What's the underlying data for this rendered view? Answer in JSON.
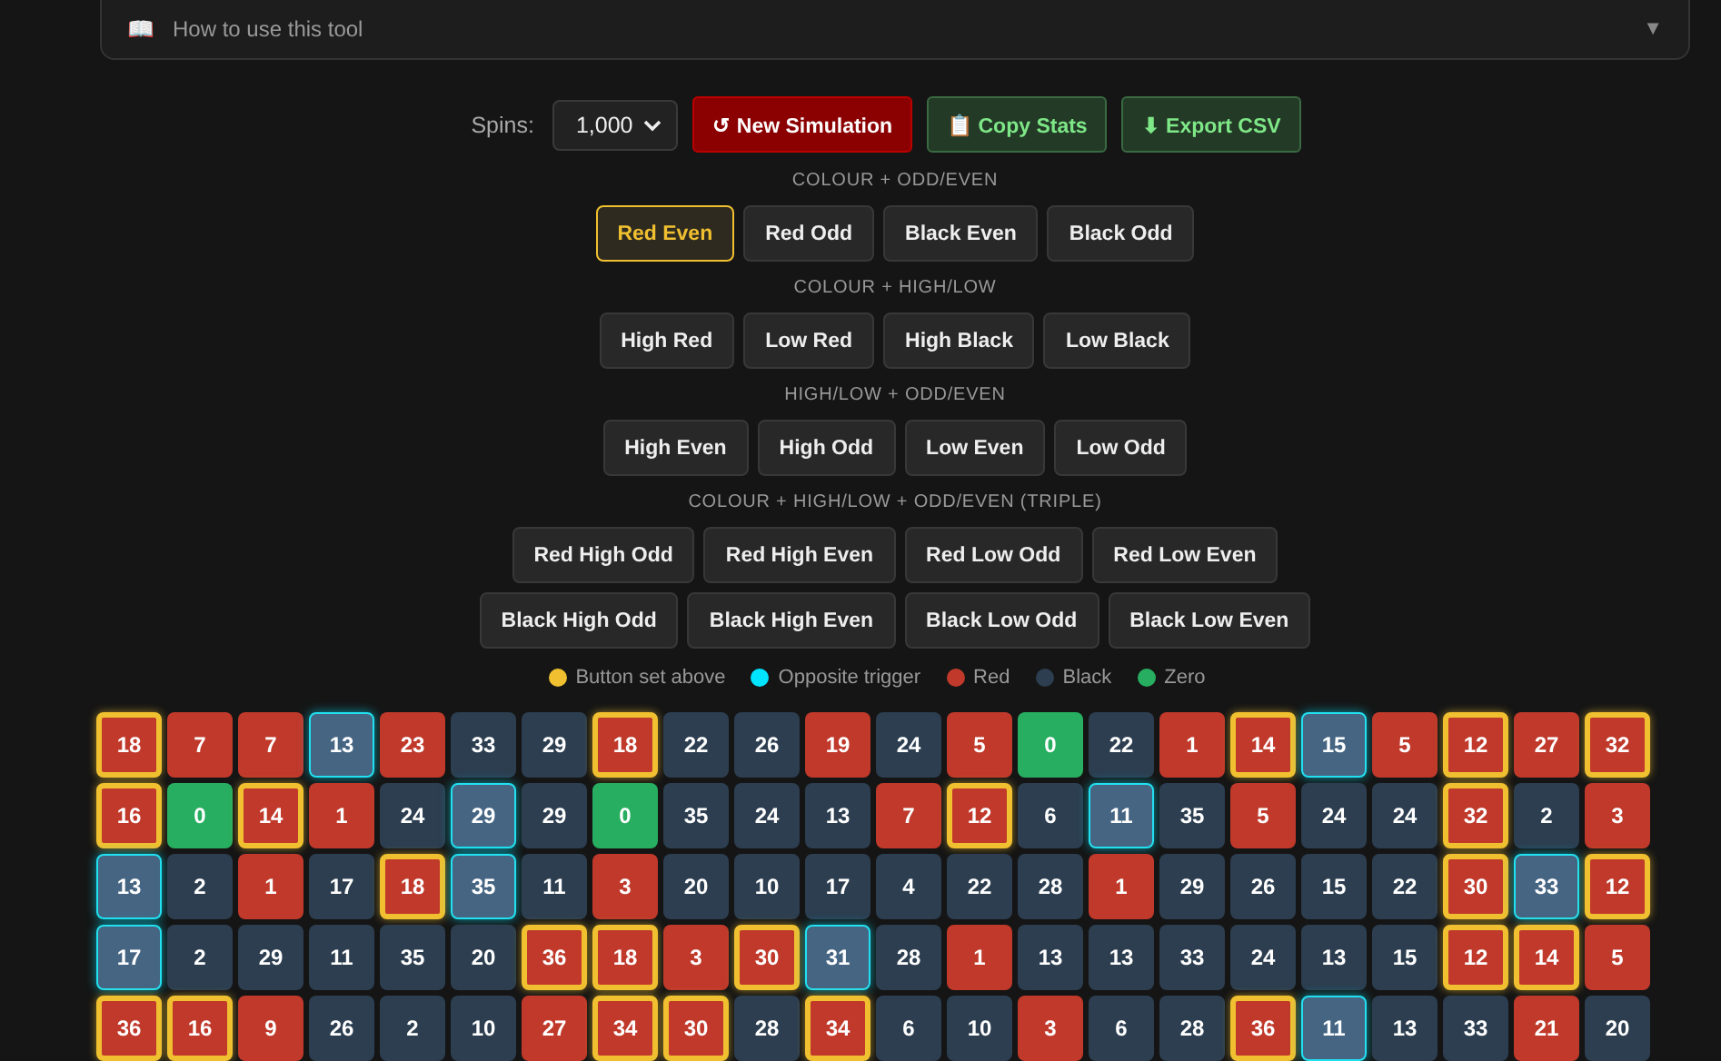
{
  "help": {
    "icon": "📖",
    "title": "How to use this tool",
    "chevron": "▼",
    "expanded": false
  },
  "controls": {
    "spins_label": "Spins:",
    "spins_value": "1,000",
    "buttons": [
      {
        "kind": "danger",
        "icon": "↺",
        "label": "New Simulation"
      },
      {
        "kind": "success",
        "icon": "📋",
        "label": "Copy Stats"
      },
      {
        "kind": "success",
        "icon": "⬇",
        "label": "Export CSV"
      }
    ]
  },
  "button_groups": [
    {
      "title": "COLOUR + ODD/EVEN",
      "rows": [
        [
          {
            "label": "Red Even",
            "selected": true
          },
          {
            "label": "Red Odd",
            "selected": false
          },
          {
            "label": "Black Even",
            "selected": false
          },
          {
            "label": "Black Odd",
            "selected": false
          }
        ]
      ]
    },
    {
      "title": "COLOUR + HIGH/LOW",
      "rows": [
        [
          {
            "label": "High Red",
            "selected": false
          },
          {
            "label": "Low Red",
            "selected": false
          },
          {
            "label": "High Black",
            "selected": false
          },
          {
            "label": "Low Black",
            "selected": false
          }
        ]
      ]
    },
    {
      "title": "HIGH/LOW + ODD/EVEN",
      "rows": [
        [
          {
            "label": "High Even",
            "selected": false
          },
          {
            "label": "High Odd",
            "selected": false
          },
          {
            "label": "Low Even",
            "selected": false
          },
          {
            "label": "Low Odd",
            "selected": false
          }
        ]
      ]
    },
    {
      "title": "COLOUR + HIGH/LOW + ODD/EVEN (TRIPLE)",
      "rows": [
        [
          {
            "label": "Red High Odd",
            "selected": false
          },
          {
            "label": "Red High Even",
            "selected": false
          },
          {
            "label": "Red Low Odd",
            "selected": false
          },
          {
            "label": "Red Low Even",
            "selected": false
          }
        ],
        [
          {
            "label": "Black High Odd",
            "selected": false
          },
          {
            "label": "Black High Even",
            "selected": false
          },
          {
            "label": "Black Low Odd",
            "selected": false
          },
          {
            "label": "Black Low Even",
            "selected": false
          }
        ]
      ]
    }
  ],
  "legend": [
    {
      "label": "Button set above",
      "color": "#f0c030"
    },
    {
      "label": "Opposite trigger",
      "color": "#00e5ff"
    },
    {
      "label": "Red",
      "color": "#c0392b"
    },
    {
      "label": "Black",
      "color": "#2c3e50"
    },
    {
      "label": "Zero",
      "color": "#27ae60"
    }
  ],
  "grid_rows": [
    [
      {
        "number": "18",
        "color": "#c0392b",
        "button_set": true,
        "opposite": false
      },
      {
        "number": "7",
        "color": "#c0392b",
        "button_set": false,
        "opposite": false
      },
      {
        "number": "7",
        "color": "#c0392b",
        "button_set": false,
        "opposite": false
      },
      {
        "number": "13",
        "color": "#456583",
        "button_set": false,
        "opposite": true
      },
      {
        "number": "23",
        "color": "#c0392b",
        "button_set": false,
        "opposite": false
      },
      {
        "number": "33",
        "color": "#2c3e50",
        "button_set": false,
        "opposite": false
      },
      {
        "number": "29",
        "color": "#2c3e50",
        "button_set": false,
        "opposite": false
      },
      {
        "number": "18",
        "color": "#c0392b",
        "button_set": true,
        "opposite": false
      },
      {
        "number": "22",
        "color": "#2c3e50",
        "button_set": false,
        "opposite": false
      },
      {
        "number": "26",
        "color": "#2c3e50",
        "button_set": false,
        "opposite": false
      },
      {
        "number": "19",
        "color": "#c0392b",
        "button_set": false,
        "opposite": false
      },
      {
        "number": "24",
        "color": "#2c3e50",
        "button_set": false,
        "opposite": false
      },
      {
        "number": "5",
        "color": "#c0392b",
        "button_set": false,
        "opposite": false
      },
      {
        "number": "0",
        "color": "#27ae60",
        "button_set": false,
        "opposite": false
      },
      {
        "number": "22",
        "color": "#2c3e50",
        "button_set": false,
        "opposite": false
      },
      {
        "number": "1",
        "color": "#c0392b",
        "button_set": false,
        "opposite": false
      },
      {
        "number": "14",
        "color": "#c0392b",
        "button_set": true,
        "opposite": false
      },
      {
        "number": "15",
        "color": "#456583",
        "button_set": false,
        "opposite": true
      },
      {
        "number": "5",
        "color": "#c0392b",
        "button_set": false,
        "opposite": false
      },
      {
        "number": "12",
        "color": "#c0392b",
        "button_set": true,
        "opposite": false
      },
      {
        "number": "27",
        "color": "#c0392b",
        "button_set": false,
        "opposite": false
      },
      {
        "number": "32",
        "color": "#c0392b",
        "button_set": true,
        "opposite": false
      }
    ],
    [
      {
        "number": "16",
        "color": "#c0392b",
        "button_set": true,
        "opposite": false
      },
      {
        "number": "0",
        "color": "#27ae60",
        "button_set": false,
        "opposite": false
      },
      {
        "number": "14",
        "color": "#c0392b",
        "button_set": true,
        "opposite": false
      },
      {
        "number": "1",
        "color": "#c0392b",
        "button_set": false,
        "opposite": false
      },
      {
        "number": "24",
        "color": "#2c3e50",
        "button_set": false,
        "opposite": false
      },
      {
        "number": "29",
        "color": "#456583",
        "button_set": false,
        "opposite": true
      },
      {
        "number": "29",
        "color": "#2c3e50",
        "button_set": false,
        "opposite": false
      },
      {
        "number": "0",
        "color": "#27ae60",
        "button_set": false,
        "opposite": false
      },
      {
        "number": "35",
        "color": "#2c3e50",
        "button_set": false,
        "opposite": false
      },
      {
        "number": "24",
        "color": "#2c3e50",
        "button_set": false,
        "opposite": false
      },
      {
        "number": "13",
        "color": "#2c3e50",
        "button_set": false,
        "opposite": false
      },
      {
        "number": "7",
        "color": "#c0392b",
        "button_set": false,
        "opposite": false
      },
      {
        "number": "12",
        "color": "#c0392b",
        "button_set": true,
        "opposite": false
      },
      {
        "number": "6",
        "color": "#2c3e50",
        "button_set": false,
        "opposite": false
      },
      {
        "number": "11",
        "color": "#456583",
        "button_set": false,
        "opposite": true
      },
      {
        "number": "35",
        "color": "#2c3e50",
        "button_set": false,
        "opposite": false
      },
      {
        "number": "5",
        "color": "#c0392b",
        "button_set": false,
        "opposite": false
      },
      {
        "number": "24",
        "color": "#2c3e50",
        "button_set": false,
        "opposite": false
      },
      {
        "number": "24",
        "color": "#2c3e50",
        "button_set": false,
        "opposite": false
      },
      {
        "number": "32",
        "color": "#c0392b",
        "button_set": true,
        "opposite": false
      },
      {
        "number": "2",
        "color": "#2c3e50",
        "button_set": false,
        "opposite": false
      },
      {
        "number": "3",
        "color": "#c0392b",
        "button_set": false,
        "opposite": false
      }
    ],
    [
      {
        "number": "13",
        "color": "#456583",
        "button_set": false,
        "opposite": true
      },
      {
        "number": "2",
        "color": "#2c3e50",
        "button_set": false,
        "opposite": false
      },
      {
        "number": "1",
        "color": "#c0392b",
        "button_set": false,
        "opposite": false
      },
      {
        "number": "17",
        "color": "#2c3e50",
        "button_set": false,
        "opposite": false
      },
      {
        "number": "18",
        "color": "#c0392b",
        "button_set": true,
        "opposite": false
      },
      {
        "number": "35",
        "color": "#456583",
        "button_set": false,
        "opposite": true
      },
      {
        "number": "11",
        "color": "#2c3e50",
        "button_set": false,
        "opposite": false
      },
      {
        "number": "3",
        "color": "#c0392b",
        "button_set": false,
        "opposite": false
      },
      {
        "number": "20",
        "color": "#2c3e50",
        "button_set": false,
        "opposite": false
      },
      {
        "number": "10",
        "color": "#2c3e50",
        "button_set": false,
        "opposite": false
      },
      {
        "number": "17",
        "color": "#2c3e50",
        "button_set": false,
        "opposite": false
      },
      {
        "number": "4",
        "color": "#2c3e50",
        "button_set": false,
        "opposite": false
      },
      {
        "number": "22",
        "color": "#2c3e50",
        "button_set": false,
        "opposite": false
      },
      {
        "number": "28",
        "color": "#2c3e50",
        "button_set": false,
        "opposite": false
      },
      {
        "number": "1",
        "color": "#c0392b",
        "button_set": false,
        "opposite": false
      },
      {
        "number": "29",
        "color": "#2c3e50",
        "button_set": false,
        "opposite": false
      },
      {
        "number": "26",
        "color": "#2c3e50",
        "button_set": false,
        "opposite": false
      },
      {
        "number": "15",
        "color": "#2c3e50",
        "button_set": false,
        "opposite": false
      },
      {
        "number": "22",
        "color": "#2c3e50",
        "button_set": false,
        "opposite": false
      },
      {
        "number": "30",
        "color": "#c0392b",
        "button_set": true,
        "opposite": false
      },
      {
        "number": "33",
        "color": "#456583",
        "button_set": false,
        "opposite": true
      },
      {
        "number": "12",
        "color": "#c0392b",
        "button_set": true,
        "opposite": false
      }
    ],
    [
      {
        "number": "17",
        "color": "#456583",
        "button_set": false,
        "opposite": true
      },
      {
        "number": "2",
        "color": "#2c3e50",
        "button_set": false,
        "opposite": false
      },
      {
        "number": "29",
        "color": "#2c3e50",
        "button_set": false,
        "opposite": false
      },
      {
        "number": "11",
        "color": "#2c3e50",
        "button_set": false,
        "opposite": false
      },
      {
        "number": "35",
        "color": "#2c3e50",
        "button_set": false,
        "opposite": false
      },
      {
        "number": "20",
        "color": "#2c3e50",
        "button_set": false,
        "opposite": false
      },
      {
        "number": "36",
        "color": "#c0392b",
        "button_set": true,
        "opposite": false
      },
      {
        "number": "18",
        "color": "#c0392b",
        "button_set": true,
        "opposite": false
      },
      {
        "number": "3",
        "color": "#c0392b",
        "button_set": false,
        "opposite": false
      },
      {
        "number": "30",
        "color": "#c0392b",
        "button_set": true,
        "opposite": false
      },
      {
        "number": "31",
        "color": "#456583",
        "button_set": false,
        "opposite": true
      },
      {
        "number": "28",
        "color": "#2c3e50",
        "button_set": false,
        "opposite": false
      },
      {
        "number": "1",
        "color": "#c0392b",
        "button_set": false,
        "opposite": false
      },
      {
        "number": "13",
        "color": "#2c3e50",
        "button_set": false,
        "opposite": false
      },
      {
        "number": "13",
        "color": "#2c3e50",
        "button_set": false,
        "opposite": false
      },
      {
        "number": "33",
        "color": "#2c3e50",
        "button_set": false,
        "opposite": false
      },
      {
        "number": "24",
        "color": "#2c3e50",
        "button_set": false,
        "opposite": false
      },
      {
        "number": "13",
        "color": "#2c3e50",
        "button_set": false,
        "opposite": false
      },
      {
        "number": "15",
        "color": "#2c3e50",
        "button_set": false,
        "opposite": false
      },
      {
        "number": "12",
        "color": "#c0392b",
        "button_set": true,
        "opposite": false
      },
      {
        "number": "14",
        "color": "#c0392b",
        "button_set": true,
        "opposite": false
      },
      {
        "number": "5",
        "color": "#c0392b",
        "button_set": false,
        "opposite": false
      }
    ],
    [
      {
        "number": "36",
        "color": "#c0392b",
        "button_set": true,
        "opposite": false
      },
      {
        "number": "16",
        "color": "#c0392b",
        "button_set": true,
        "opposite": false
      },
      {
        "number": "9",
        "color": "#c0392b",
        "button_set": false,
        "opposite": false
      },
      {
        "number": "26",
        "color": "#2c3e50",
        "button_set": false,
        "opposite": false
      },
      {
        "number": "2",
        "color": "#2c3e50",
        "button_set": false,
        "opposite": false
      },
      {
        "number": "10",
        "color": "#2c3e50",
        "button_set": false,
        "opposite": false
      },
      {
        "number": "27",
        "color": "#c0392b",
        "button_set": false,
        "opposite": false
      },
      {
        "number": "34",
        "color": "#c0392b",
        "button_set": true,
        "opposite": false
      },
      {
        "number": "30",
        "color": "#c0392b",
        "button_set": true,
        "opposite": false
      },
      {
        "number": "28",
        "color": "#2c3e50",
        "button_set": false,
        "opposite": false
      },
      {
        "number": "34",
        "color": "#c0392b",
        "button_set": true,
        "opposite": false
      },
      {
        "number": "6",
        "color": "#2c3e50",
        "button_set": false,
        "opposite": false
      },
      {
        "number": "10",
        "color": "#2c3e50",
        "button_set": false,
        "opposite": false
      },
      {
        "number": "3",
        "color": "#c0392b",
        "button_set": false,
        "opposite": false
      },
      {
        "number": "6",
        "color": "#2c3e50",
        "button_set": false,
        "opposite": false
      },
      {
        "number": "28",
        "color": "#2c3e50",
        "button_set": false,
        "opposite": false
      },
      {
        "number": "36",
        "color": "#c0392b",
        "button_set": true,
        "opposite": false
      },
      {
        "number": "11",
        "color": "#456583",
        "button_set": false,
        "opposite": true
      },
      {
        "number": "13",
        "color": "#2c3e50",
        "button_set": false,
        "opposite": false
      },
      {
        "number": "33",
        "color": "#2c3e50",
        "button_set": false,
        "opposite": false
      },
      {
        "number": "21",
        "color": "#c0392b",
        "button_set": false,
        "opposite": false
      },
      {
        "number": "20",
        "color": "#2c3e50",
        "button_set": false,
        "opposite": false
      }
    ]
  ]
}
